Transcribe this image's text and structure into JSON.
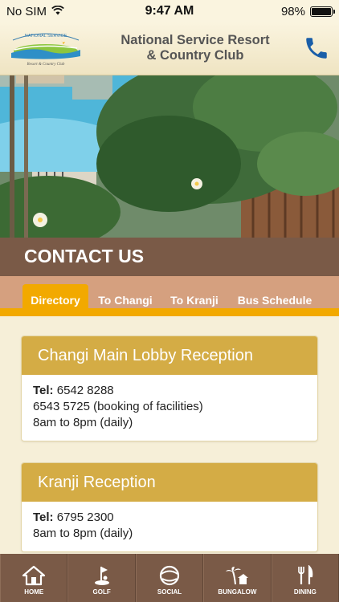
{
  "status_bar": {
    "carrier": "No SIM",
    "time": "9:47 AM",
    "battery": "98%",
    "battery_level": 0.98
  },
  "header": {
    "title_line1": "National Service Resort",
    "title_line2": "& Country Club",
    "logo_text": "NATIONAL SERVICE",
    "logo_subtext": "Resort & Country Club",
    "phone_icon": "phone-icon"
  },
  "page": {
    "title": "CONTACT US"
  },
  "tabs": [
    {
      "label": "Directory",
      "active": true
    },
    {
      "label": "To Changi",
      "active": false
    },
    {
      "label": "To Kranji",
      "active": false
    },
    {
      "label": "Bus Schedule",
      "active": false
    }
  ],
  "cards": [
    {
      "title": "Changi Main Lobby Reception",
      "tel_label": "Tel:",
      "tel": "6542 8288",
      "line2": "6543 5725 (booking of facilities)",
      "line3": "8am to 8pm (daily)"
    },
    {
      "title": "Kranji Reception",
      "tel_label": "Tel:",
      "tel": "6795 2300",
      "line2": "8am to 8pm (daily)"
    }
  ],
  "bottom_nav": [
    {
      "label": "HOME",
      "icon": "home-icon"
    },
    {
      "label": "GOLF",
      "icon": "golf-icon"
    },
    {
      "label": "SOCIAL",
      "icon": "social-icon"
    },
    {
      "label": "BUNGALOW",
      "icon": "bungalow-icon"
    },
    {
      "label": "DINING",
      "icon": "dining-icon"
    }
  ],
  "colors": {
    "brown": "#7a5a47",
    "tan": "#d5a07f",
    "orange": "#f2a900",
    "gold": "#d4ac45",
    "cream": "#f6efd8",
    "phone": "#1a5ea8"
  }
}
